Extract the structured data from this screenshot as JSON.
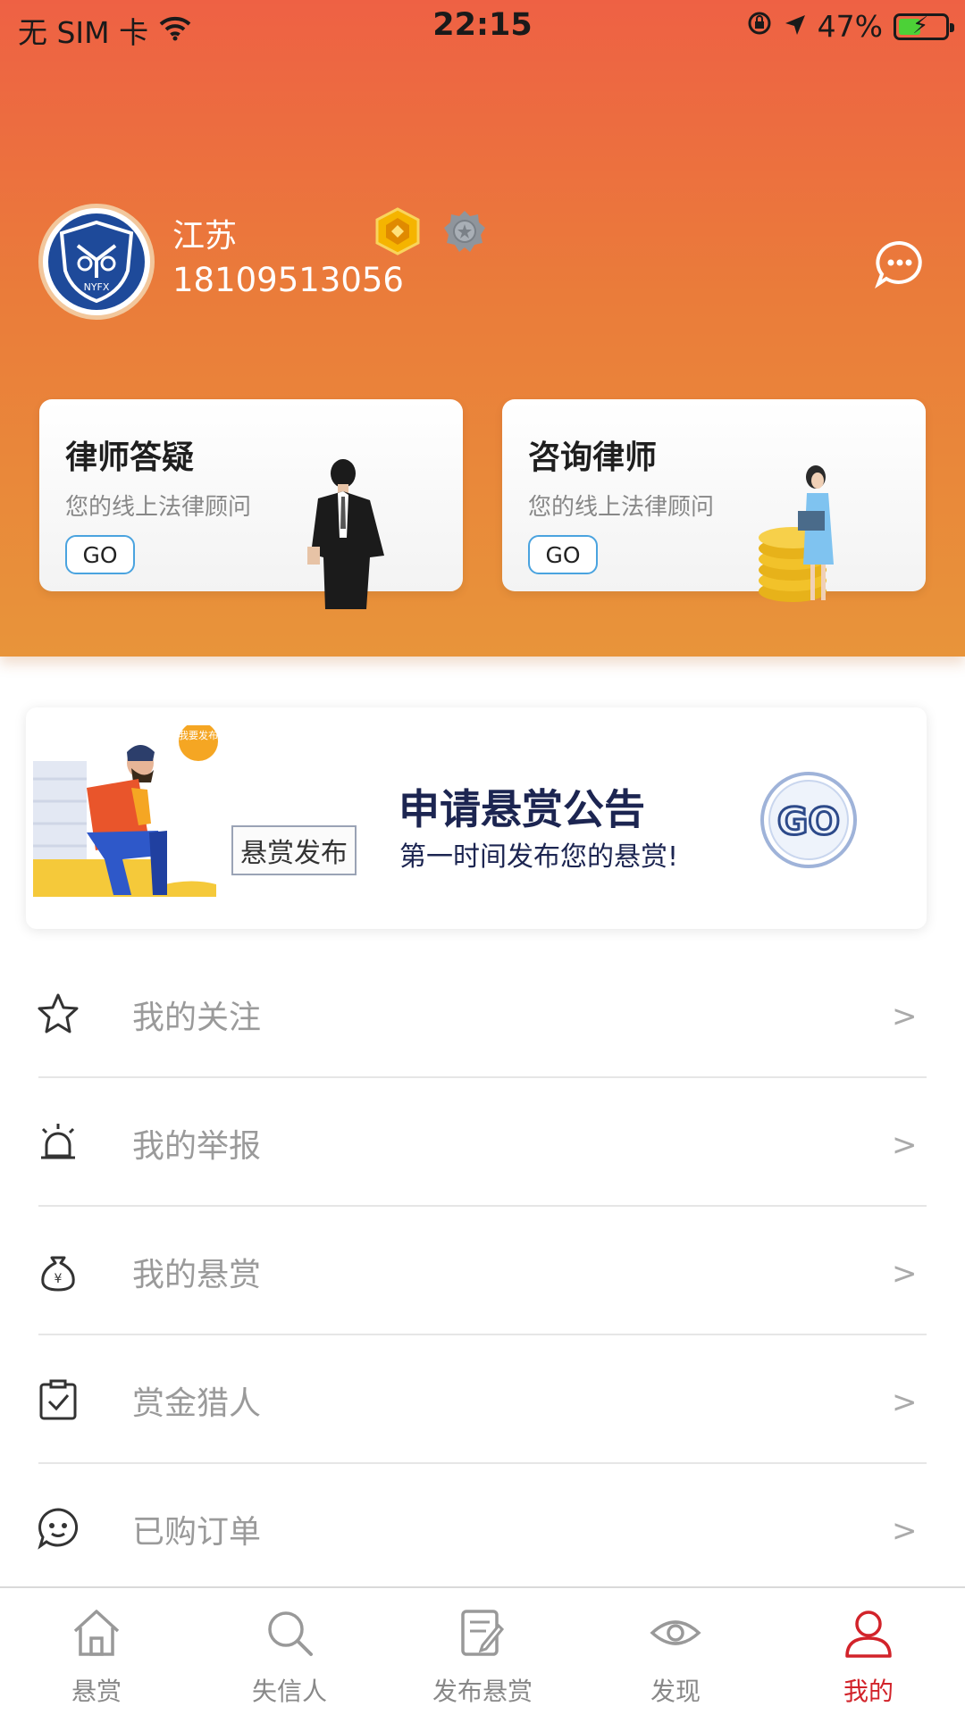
{
  "status_bar": {
    "carrier": "无 SIM 卡",
    "time": "22:15",
    "battery": "47%",
    "battery_level": 0.47
  },
  "profile": {
    "avatar_text": "NYFX",
    "name": "江苏",
    "phone": "18109513056"
  },
  "cards": [
    {
      "title": "律师答疑",
      "subtitle": "您的线上法律顾问",
      "go": "GO"
    },
    {
      "title": "咨询律师",
      "subtitle": "您的线上法律顾问",
      "go": "GO"
    }
  ],
  "banner": {
    "bubble": "我要发布",
    "tag": "悬赏发布",
    "title": "申请悬赏公告",
    "subtitle": "第一时间发布您的悬赏!",
    "go": "GO"
  },
  "menu": [
    {
      "label": "我的关注",
      "icon": "star-icon",
      "arrow": ">"
    },
    {
      "label": "我的举报",
      "icon": "alarm-icon",
      "arrow": ">"
    },
    {
      "label": "我的悬赏",
      "icon": "money-bag-icon",
      "arrow": ">"
    },
    {
      "label": "赏金猎人",
      "icon": "clipboard-check-icon",
      "arrow": ">"
    },
    {
      "label": "已购订单",
      "icon": "chat-face-icon",
      "arrow": ">"
    }
  ],
  "tabbar": [
    {
      "label": "悬赏",
      "icon": "home-icon",
      "active": false
    },
    {
      "label": "失信人",
      "icon": "search-icon",
      "active": false
    },
    {
      "label": "发布悬赏",
      "icon": "edit-doc-icon",
      "active": false
    },
    {
      "label": "发现",
      "icon": "eye-icon",
      "active": false
    },
    {
      "label": "我的",
      "icon": "user-icon",
      "active": true
    }
  ],
  "colors": {
    "header_top": "#ee6144",
    "header_bottom": "#e8943a",
    "active_tab": "#d2232a",
    "banner_text": "#1c2551"
  }
}
